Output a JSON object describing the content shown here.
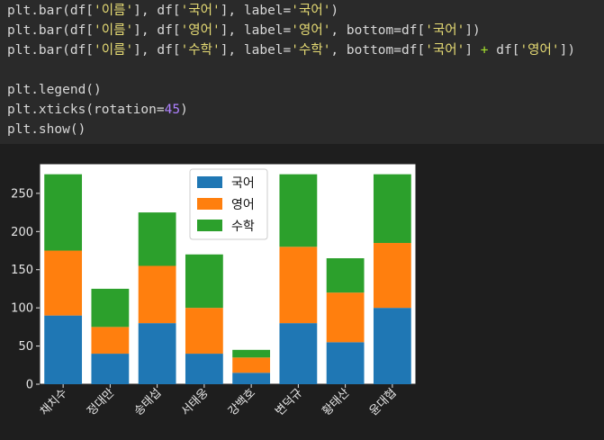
{
  "code": {
    "lines": [
      [
        {
          "t": "plt.bar(df["
        },
        {
          "t": "'이름'",
          "c": "str"
        },
        {
          "t": "], df["
        },
        {
          "t": "'국어'",
          "c": "str"
        },
        {
          "t": "], label="
        },
        {
          "t": "'국어'",
          "c": "str"
        },
        {
          "t": ")"
        }
      ],
      [
        {
          "t": "plt.bar(df["
        },
        {
          "t": "'이름'",
          "c": "str"
        },
        {
          "t": "], df["
        },
        {
          "t": "'영어'",
          "c": "str"
        },
        {
          "t": "], label="
        },
        {
          "t": "'영어'",
          "c": "str"
        },
        {
          "t": ", bottom=df["
        },
        {
          "t": "'국어'",
          "c": "str"
        },
        {
          "t": "])"
        }
      ],
      [
        {
          "t": "plt.bar(df["
        },
        {
          "t": "'이름'",
          "c": "str"
        },
        {
          "t": "], df["
        },
        {
          "t": "'수학'",
          "c": "str"
        },
        {
          "t": "], label="
        },
        {
          "t": "'수학'",
          "c": "str"
        },
        {
          "t": ", bottom=df["
        },
        {
          "t": "'국어'",
          "c": "str"
        },
        {
          "t": "] "
        },
        {
          "t": "+",
          "c": "op"
        },
        {
          "t": " df["
        },
        {
          "t": "'영어'",
          "c": "str"
        },
        {
          "t": "])"
        }
      ],
      [],
      [
        {
          "t": "plt.legend()"
        }
      ],
      [
        {
          "t": "plt.xticks(rotation="
        },
        {
          "t": "45",
          "c": "num"
        },
        {
          "t": ")"
        }
      ],
      [
        {
          "t": "plt.show()"
        }
      ]
    ]
  },
  "chart_data": {
    "type": "bar",
    "stacked": true,
    "categories": [
      "채치수",
      "정대만",
      "송태섭",
      "서태웅",
      "강백호",
      "변덕규",
      "황태산",
      "윤대협"
    ],
    "series": [
      {
        "name": "국어",
        "values": [
          90,
          40,
          80,
          40,
          15,
          80,
          55,
          100
        ],
        "color": "#1f77b4"
      },
      {
        "name": "영어",
        "values": [
          85,
          35,
          75,
          60,
          20,
          100,
          65,
          85
        ],
        "color": "#ff7f0e"
      },
      {
        "name": "수학",
        "values": [
          100,
          50,
          70,
          70,
          10,
          95,
          45,
          90
        ],
        "color": "#2ca02c"
      }
    ],
    "yticks": [
      0,
      50,
      100,
      150,
      200,
      250
    ],
    "ylim": [
      0,
      288.75
    ],
    "xtick_rotation": 45,
    "legend": "upper-center",
    "grid": false
  }
}
